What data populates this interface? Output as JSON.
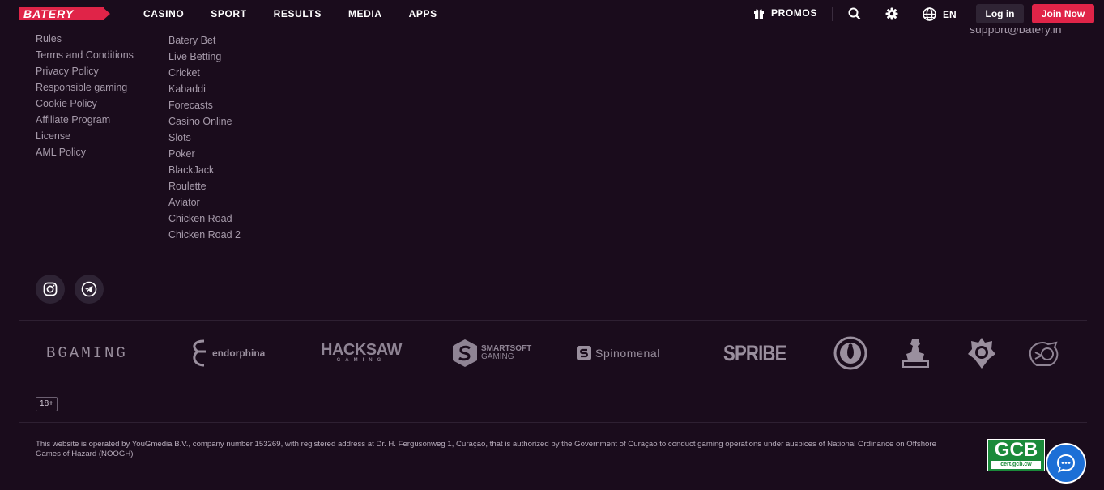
{
  "header": {
    "logo_text": "BATERY",
    "nav": [
      "CASINO",
      "SPORT",
      "RESULTS",
      "MEDIA",
      "APPS"
    ],
    "promos_label": "PROMOS",
    "language": "EN",
    "login_label": "Log in",
    "join_label": "Join Now"
  },
  "contact": {
    "email": "support@batery.in"
  },
  "footer": {
    "info_links": [
      "Rules",
      "Terms and Conditions",
      "Privacy Policy",
      "Responsible gaming",
      "Cookie Policy",
      "Affiliate Program",
      "License",
      "AML Policy"
    ],
    "betting_links": [
      "Batery Bet",
      "Live Betting",
      "Cricket",
      "Kabaddi",
      "Forecasts",
      "Casino Online",
      "Slots",
      "Poker",
      "BlackJack",
      "Roulette",
      "Aviator",
      "Chicken Road",
      "Chicken Road 2"
    ],
    "social": [
      "instagram-icon",
      "telegram-icon"
    ],
    "providers": {
      "bgaming": "BGAMING",
      "endorphina": "endorphina",
      "hacksaw": "HACKSAW",
      "hacksaw_sub": "GAMING",
      "smartsoft": "SMARTSOFT",
      "smartsoft_sub": "GAMING",
      "spinomenal": "Spinomenal",
      "spribe": "SPRIBE"
    },
    "age_badge": "18+",
    "legal_text": "This website is operated by YouGmedia B.V., company number 153269, with registered address at Dr. H. Fergusonweg 1, Curaçao, that is authorized by the Government of Curaçao to conduct gaming operations under auspices of National Ordinance on Offshore Games of Hazard (NOOGH)",
    "license_badge": {
      "title": "GCB",
      "subtitle": "cert.gcb.cw"
    }
  },
  "colors": {
    "background": "#1a0c1c",
    "brand": "#e02448",
    "chat": "#1c6fd6",
    "gcb": "#1a8a3a"
  }
}
